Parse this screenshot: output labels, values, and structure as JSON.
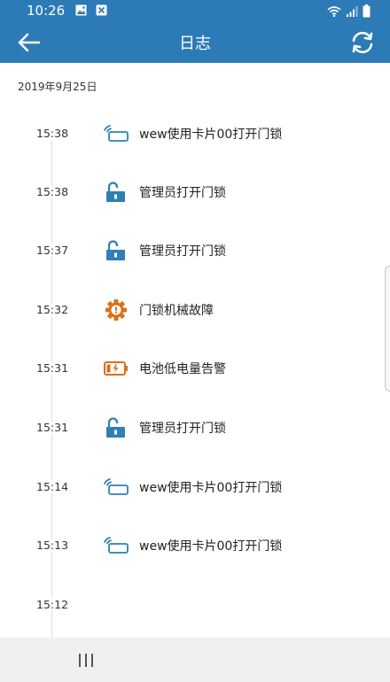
{
  "status_bar": {
    "time": "10:26",
    "left_icons": [
      "gallery-icon",
      "close-box-icon"
    ],
    "right_icons": [
      "wifi-icon",
      "signal-icon",
      "battery-icon"
    ]
  },
  "header": {
    "title": "日志",
    "back_icon": "arrow-left-icon",
    "refresh_icon": "refresh-icon",
    "color": "#2c7bb6"
  },
  "log": {
    "date": "2019年9月25日",
    "entries": [
      {
        "time": "15:38",
        "icon": "card-wave-icon",
        "message": "wew使用卡片00打开门锁"
      },
      {
        "time": "15:38",
        "icon": "unlock-icon",
        "message": "管理员打开门锁"
      },
      {
        "time": "15:37",
        "icon": "unlock-icon",
        "message": "管理员打开门锁"
      },
      {
        "time": "15:32",
        "icon": "gear-warning-icon",
        "message": "门锁机械故障"
      },
      {
        "time": "15:31",
        "icon": "battery-low-icon",
        "message": "电池低电量告警"
      },
      {
        "time": "15:31",
        "icon": "unlock-icon",
        "message": "管理员打开门锁"
      },
      {
        "time": "15:14",
        "icon": "card-wave-icon",
        "message": "wew使用卡片00打开门锁"
      },
      {
        "time": "15:13",
        "icon": "card-wave-icon",
        "message": "wew使用卡片00打开门锁"
      },
      {
        "time": "15:12",
        "icon": "",
        "message": ""
      }
    ]
  },
  "colors": {
    "blue_icon": "#2f7fb3",
    "orange_icon": "#d9701c",
    "timeline": "#dcdcdc"
  },
  "nav_bar": {
    "recents_icon": "recents-icon"
  }
}
